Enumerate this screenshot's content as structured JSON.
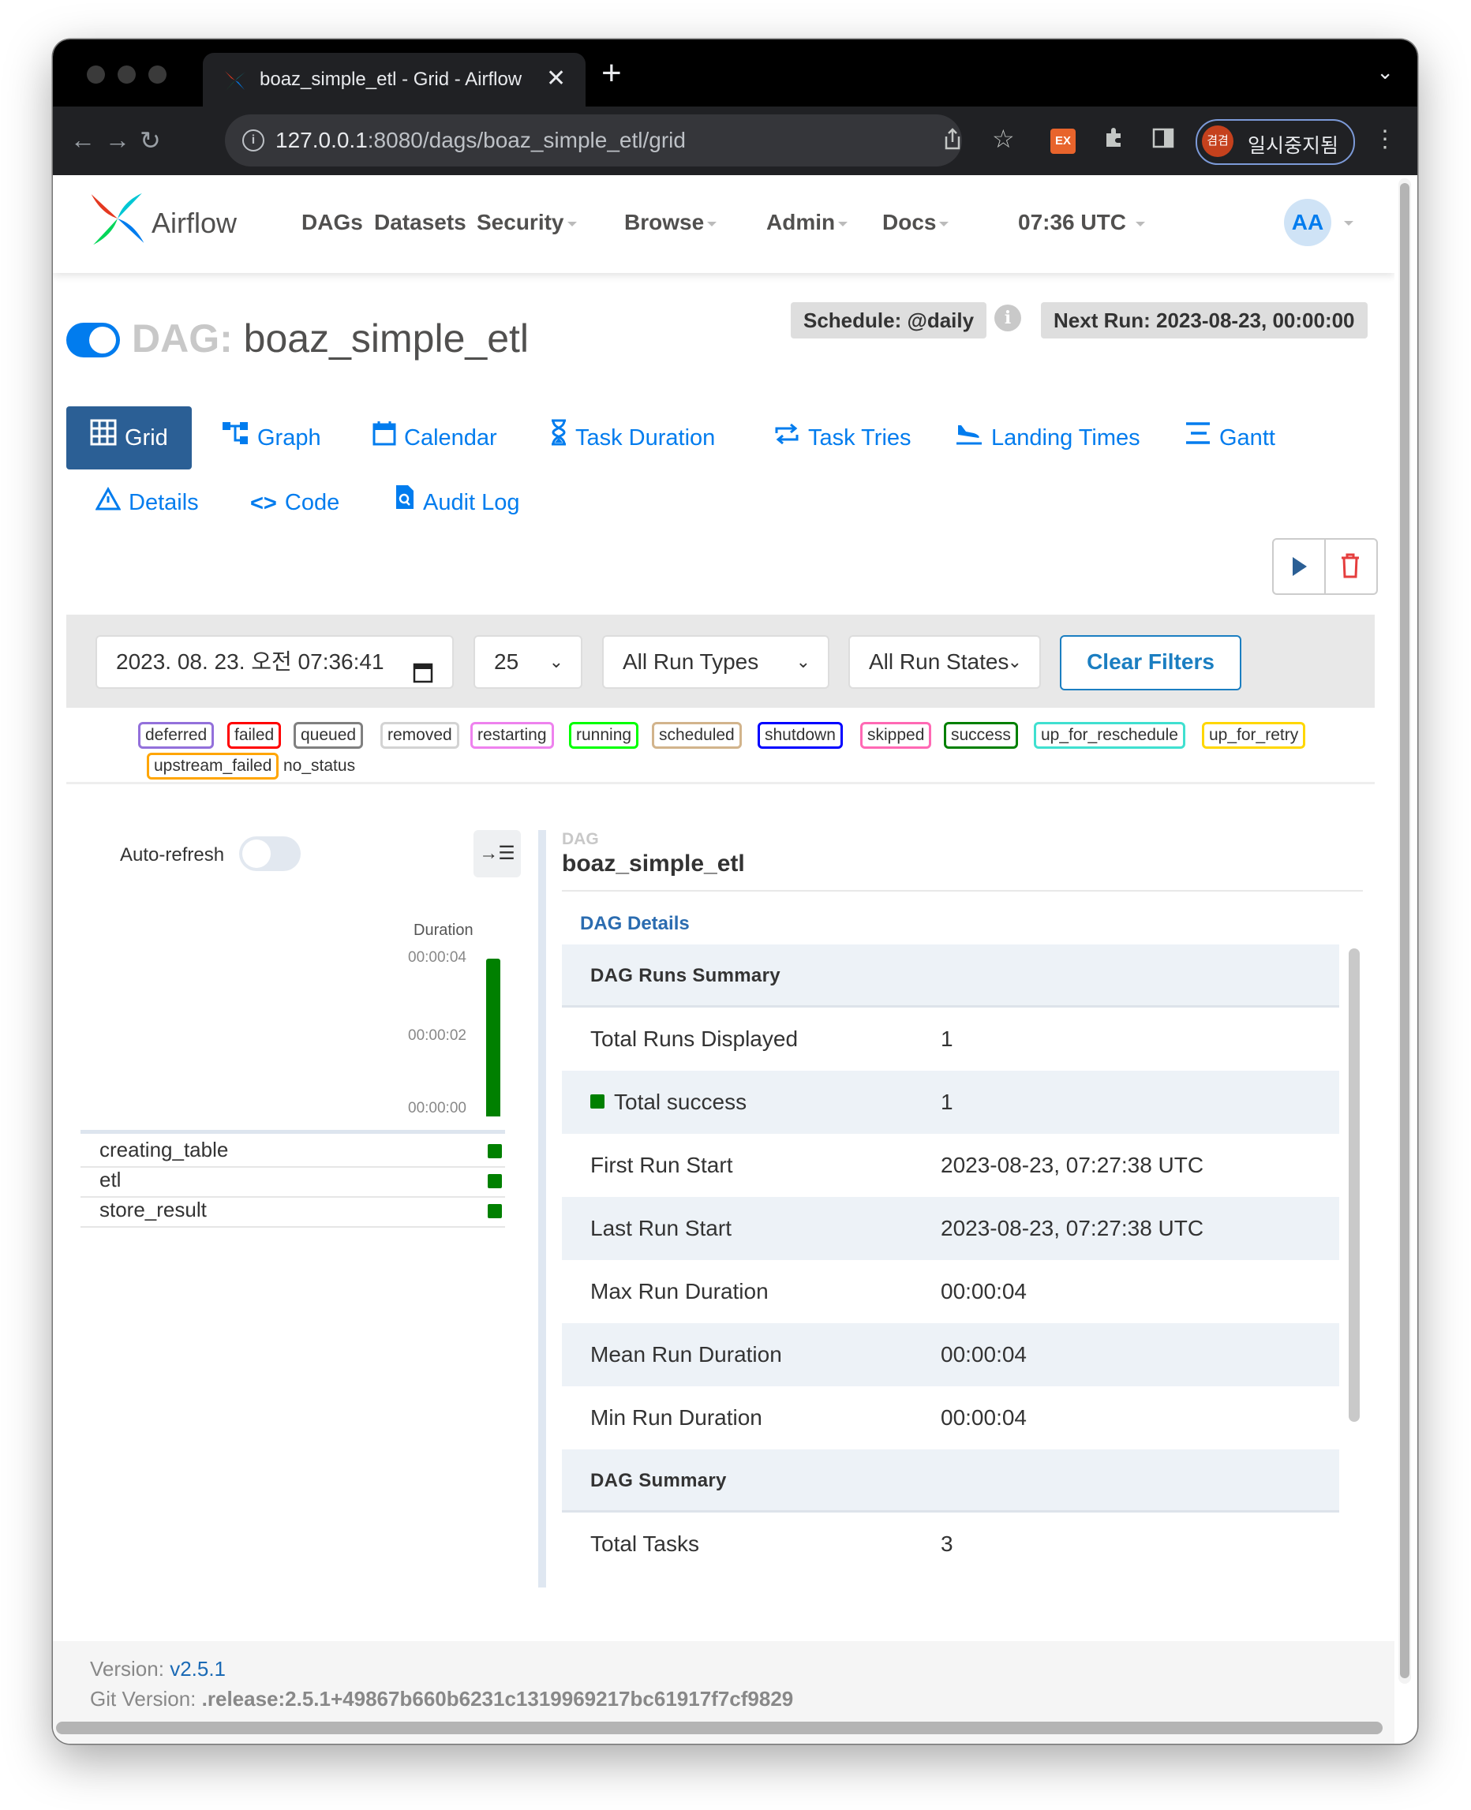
{
  "browser": {
    "tab_title": "boaz_simple_etl - Grid - Airflow",
    "url_host": "127.0.0.1",
    "url_rest": ":8080/dags/boaz_simple_etl/grid",
    "extension_label": "EX",
    "profile_avatar": "겸겸",
    "profile_label": "일시중지됨",
    "new_tab": "+",
    "close_tab": "✕"
  },
  "navbar": {
    "brand": "Airflow",
    "items": [
      {
        "label": "DAGs",
        "dropdown": false
      },
      {
        "label": "Datasets",
        "dropdown": false
      },
      {
        "label": "Security",
        "dropdown": true
      },
      {
        "label": "Browse",
        "dropdown": true
      },
      {
        "label": "Admin",
        "dropdown": true
      },
      {
        "label": "Docs",
        "dropdown": true
      }
    ],
    "clock": "07:36 UTC",
    "user_initials": "AA"
  },
  "dag": {
    "prefix": "DAG:",
    "name": "boaz_simple_etl",
    "schedule": "Schedule: @daily",
    "next_run": "Next Run: 2023-08-23, 00:00:00",
    "paused": false
  },
  "views": {
    "tabs": [
      "Grid",
      "Graph",
      "Calendar",
      "Task Duration",
      "Task Tries",
      "Landing Times",
      "Gantt",
      "Details",
      "Code",
      "Audit Log"
    ],
    "active": "Grid"
  },
  "filters": {
    "date": "2023. 08. 23. 오전 07:36:41",
    "num_runs": "25",
    "run_type": "All Run Types",
    "run_state": "All Run States",
    "clear_label": "Clear Filters"
  },
  "legend": [
    {
      "label": "deferred",
      "color": "#9370db"
    },
    {
      "label": "failed",
      "color": "#ff0000"
    },
    {
      "label": "queued",
      "color": "#808080"
    },
    {
      "label": "removed",
      "color": "#d3d3d3"
    },
    {
      "label": "restarting",
      "color": "#ee82ee"
    },
    {
      "label": "running",
      "color": "#00ff00"
    },
    {
      "label": "scheduled",
      "color": "#d2b48c"
    },
    {
      "label": "shutdown",
      "color": "#0000ff"
    },
    {
      "label": "skipped",
      "color": "#ff69b4"
    },
    {
      "label": "success",
      "color": "#008000"
    },
    {
      "label": "up_for_reschedule",
      "color": "#40e0d0"
    },
    {
      "label": "up_for_retry",
      "color": "#ffd700"
    },
    {
      "label": "upstream_failed",
      "color": "#ffa500"
    },
    {
      "label": "no_status",
      "color": "none"
    }
  ],
  "grid": {
    "auto_refresh_label": "Auto-refresh",
    "auto_refresh_on": false,
    "duration_label": "Duration",
    "duration_ticks": [
      "00:00:04",
      "00:00:02",
      "00:00:00"
    ],
    "run_duration_seconds": 4,
    "run_state_color": "#008000",
    "tasks": [
      {
        "name": "creating_table",
        "state": "success"
      },
      {
        "name": "etl",
        "state": "success"
      },
      {
        "name": "store_result",
        "state": "success"
      }
    ]
  },
  "details": {
    "small_label": "DAG",
    "title": "boaz_simple_etl",
    "link": "DAG Details",
    "runs_summary_header": "DAG Runs Summary",
    "rows": [
      {
        "k": "Total Runs Displayed",
        "v": "1"
      },
      {
        "k": "Total success",
        "v": "1"
      },
      {
        "k": "First Run Start",
        "v": "2023-08-23, 07:27:38 UTC"
      },
      {
        "k": "Last Run Start",
        "v": "2023-08-23, 07:27:38 UTC"
      },
      {
        "k": "Max Run Duration",
        "v": "00:00:04"
      },
      {
        "k": "Mean Run Duration",
        "v": "00:00:04"
      },
      {
        "k": "Min Run Duration",
        "v": "00:00:04"
      }
    ],
    "dag_summary_header": "DAG Summary",
    "total_tasks_label": "Total Tasks",
    "total_tasks_value": "3"
  },
  "footer": {
    "version_label": "Version:",
    "version": "v2.5.1",
    "git_label": "Git Version:",
    "git": ".release:2.5.1+49867b660b6231c1319969217bc61917f7cf9829"
  }
}
